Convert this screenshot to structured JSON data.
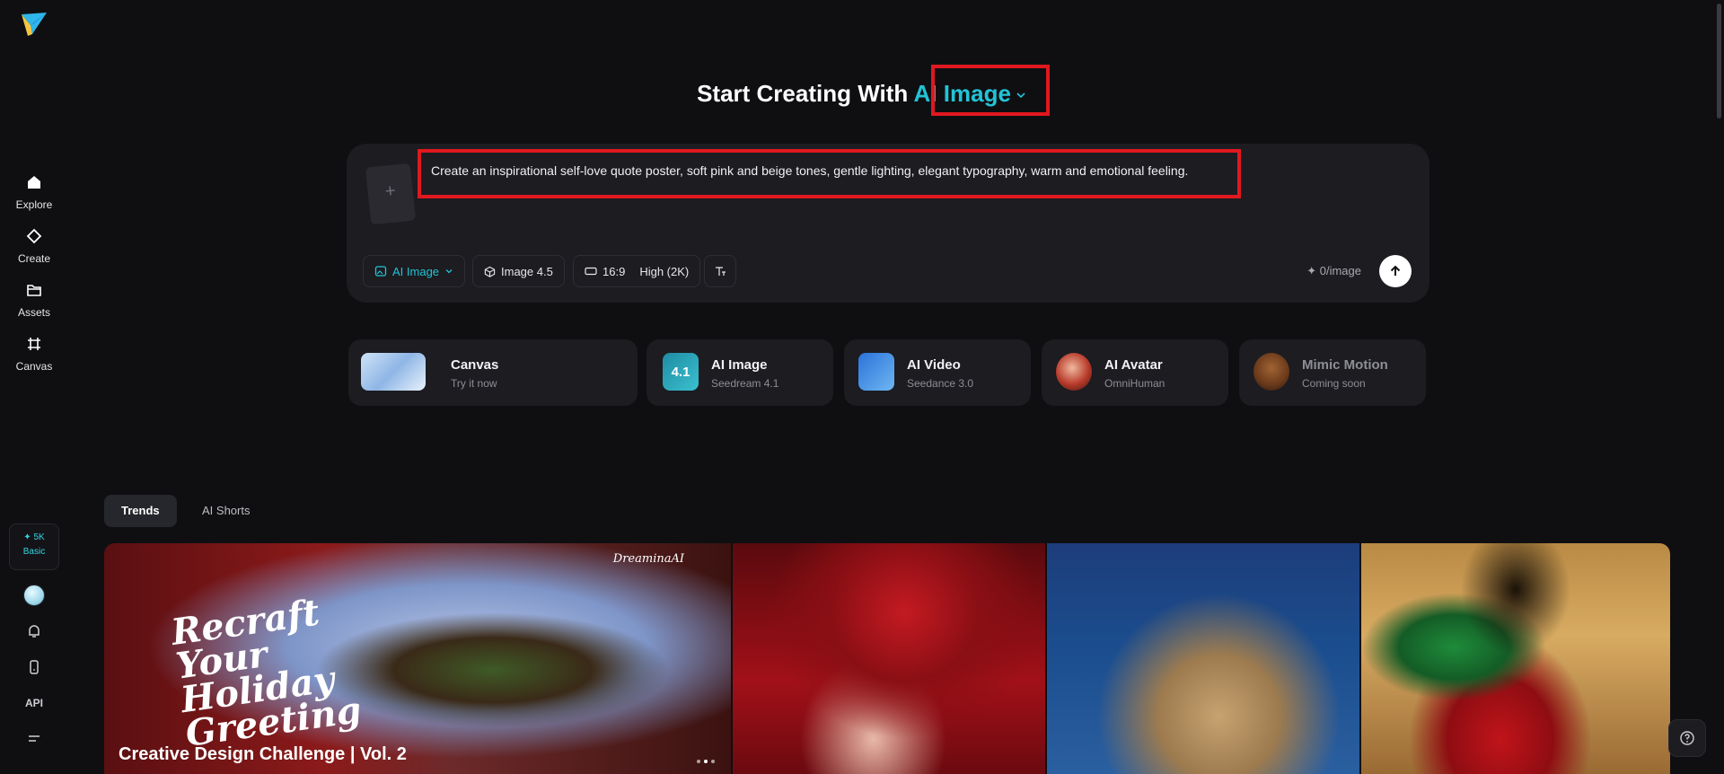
{
  "sidebar": {
    "logo": "dreamina-logo",
    "items": [
      {
        "label": "Explore",
        "icon": "home-icon"
      },
      {
        "label": "Create",
        "icon": "diamond-icon"
      },
      {
        "label": "Assets",
        "icon": "folder-icon"
      },
      {
        "label": "Canvas",
        "icon": "canvas-icon"
      }
    ],
    "credits": {
      "amount": "✦ 5K",
      "plan": "Basic"
    },
    "api_label": "API"
  },
  "header": {
    "title_prefix": "Start Creating With",
    "mode": "AI Image"
  },
  "prompt": {
    "text": "Create an inspirational self-love quote poster, soft pink and beige tones, gentle lighting, elegant typography, warm and emotional feeling.",
    "upload_icon": "+",
    "chips": {
      "mode": "AI Image",
      "model": "Image 4.5",
      "ratio": "16:9",
      "quality": "High (2K)"
    },
    "cost": "0/image",
    "cost_icon": "✦"
  },
  "features": [
    {
      "title": "Canvas",
      "subtitle": "Try it now"
    },
    {
      "title": "AI Image",
      "subtitle": "Seedream 4.1",
      "badge": "4.1"
    },
    {
      "title": "AI Video",
      "subtitle": "Seedance 3.0"
    },
    {
      "title": "AI Avatar",
      "subtitle": "OmniHuman"
    },
    {
      "title": "Mimic Motion",
      "subtitle": "Coming soon"
    }
  ],
  "tabs": [
    "Trends",
    "AI Shorts"
  ],
  "gallery": {
    "featured_title": "Creative Design Challenge | Vol. 2",
    "featured_art_text": "Recraft Your Holiday Greeting",
    "brand": "DreaminaAI"
  },
  "colors": {
    "accent": "#22c3d6",
    "highlight": "#e0181f",
    "background": "#0f0f12"
  }
}
